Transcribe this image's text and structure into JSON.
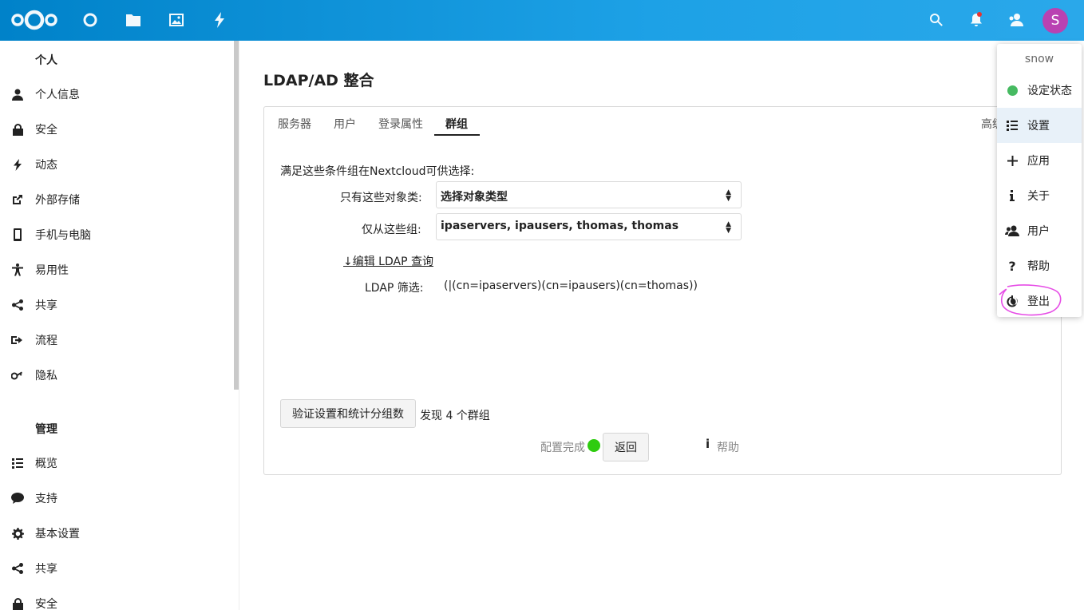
{
  "header": {
    "avatar_letter": "S",
    "icons": [
      "nextcloud-logo",
      "dashboard-icon",
      "files-icon",
      "photos-icon",
      "activity-icon",
      "search-icon",
      "notifications-icon",
      "contacts-icon"
    ]
  },
  "sidebar": {
    "personal_heading": "个人",
    "personal_items": [
      "个人信息",
      "安全",
      "动态",
      "外部存储",
      "手机与电脑",
      "易用性",
      "共享",
      "流程",
      "隐私"
    ],
    "admin_heading": "管理",
    "admin_items": [
      "概览",
      "支持",
      "基本设置",
      "共享",
      "安全"
    ]
  },
  "main": {
    "title": "LDAP/AD 整合",
    "tabs": [
      "服务器",
      "用户",
      "登录属性",
      "群组"
    ],
    "active_tab": "群组",
    "advanced_tab": "高级",
    "intro": "满足这些条件组在Nextcloud可供选择:",
    "object_class_label": "只有这些对象类:",
    "object_class_value": "选择对象类型",
    "groups_label": "仅从这些组:",
    "groups_value": "ipaservers, ipausers, thomas, thomas",
    "edit_query_link": "↓编辑 LDAP 查询",
    "filter_label": "LDAP 筛选:",
    "filter_value": "(|(cn=ipaservers)(cn=ipausers)(cn=thomas))",
    "verify_button": "验证设置和统计分组数",
    "found_text": "发现 4 个群组",
    "config_done": "配置完成",
    "back_button": "返回",
    "help_label": "帮助"
  },
  "menu": {
    "username": "snow",
    "items": [
      "设定状态",
      "设置",
      "应用",
      "关于",
      "用户",
      "帮助",
      "登出"
    ],
    "active": "设置"
  },
  "colors": {
    "header": "#0082c9",
    "status_online": "#46ba61",
    "config_ok": "#2ecc0f",
    "avatar": "#b942b2",
    "highlight": "#e64de6"
  }
}
